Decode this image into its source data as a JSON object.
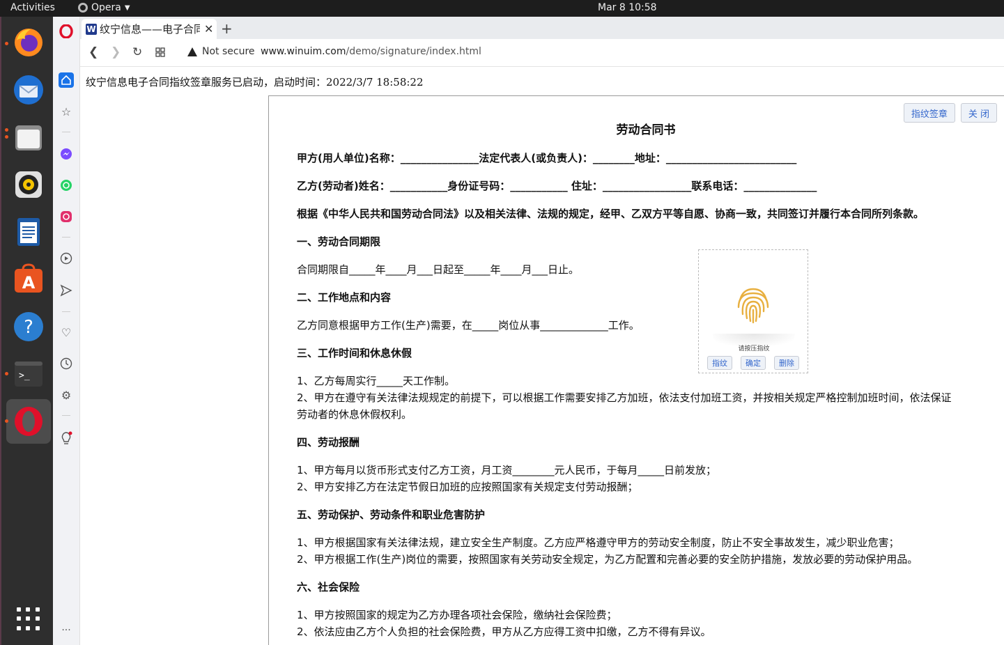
{
  "topbar": {
    "activities": "Activities",
    "app_name": "Opera",
    "clock": "Mar 8  10:58"
  },
  "dock": {
    "items": [
      "firefox-icon",
      "thunderbird-icon",
      "files-icon",
      "rhythmbox-icon",
      "libreoffice-writer-icon",
      "ubuntu-software-icon",
      "help-icon",
      "terminal-icon",
      "opera-icon"
    ],
    "show_apps": "show-applications-icon"
  },
  "browser": {
    "tab_title": "纹宁信息——电子合同",
    "favicon_letter": "W",
    "new_tab": "+",
    "tab_close": "✕",
    "not_secure": "Not secure",
    "url_host": "www.winuim.com",
    "url_path": "/demo/signature/index.html"
  },
  "page": {
    "status": "纹宁信息电子合同指纹签章服务已启动，启动时间：2022/3/7 18:58:22",
    "buttons": {
      "sign": "指纹签章",
      "close": "关 闭"
    },
    "title": "劳动合同书",
    "lines": [
      "甲方(用人单位)名称：_______________法定代表人(或负责人)：________地址：_________________________",
      "乙方(劳动者)姓名：___________身份证号码：___________ 住址：_________________联系电话：______________",
      "根据《中华人民共和国劳动合同法》以及相关法律、法规的规定，经甲、乙双方平等自愿、协商一致，共同签订并履行本合同所列条款。",
      "一、劳动合同期限",
      "合同期限自_____年____月___日起至_____年____月___日止。",
      "二、工作地点和内容",
      "乙方同意根据甲方工作(生产)需要，在_____岗位从事_____________工作。",
      "三、工作时间和休息休假",
      "1、乙方每周实行_____天工作制。",
      "2、甲方在遵守有关法律法规规定的前提下，可以根据工作需要安排乙方加班，依法支付加班工资，并按相关规定严格控制加班时间，依法保证",
      "劳动者的休息休假权利。",
      "四、劳动报酬",
      "1、甲方每月以货币形式支付乙方工资，月工资________元人民币，于每月_____日前发放；",
      "2、甲方安排乙方在法定节假日加班的应按照国家有关规定支付劳动报酬；",
      "五、劳动保护、劳动条件和职业危害防护",
      "1、甲方根据国家有关法律法规，建立安全生产制度。乙方应严格遵守甲方的劳动安全制度，防止不安全事故发生，减少职业危害；",
      "2、甲方根据工作(生产)岗位的需要，按照国家有关劳动安全规定，为乙方配置和完善必要的安全防护措施，发放必要的劳动保护用品。",
      "六、社会保险",
      "1、甲方按照国家的规定为乙方办理各项社会保险，缴纳社会保险费；",
      "2、依法应由乙方个人负担的社会保险费，甲方从乙方应得工资中扣缴，乙方不得有异议。"
    ],
    "fingerprint": {
      "hint": "请按压指纹",
      "buttons": {
        "capture": "指纹",
        "confirm": "确定",
        "delete": "删除"
      },
      "color": "#e8b040"
    }
  }
}
